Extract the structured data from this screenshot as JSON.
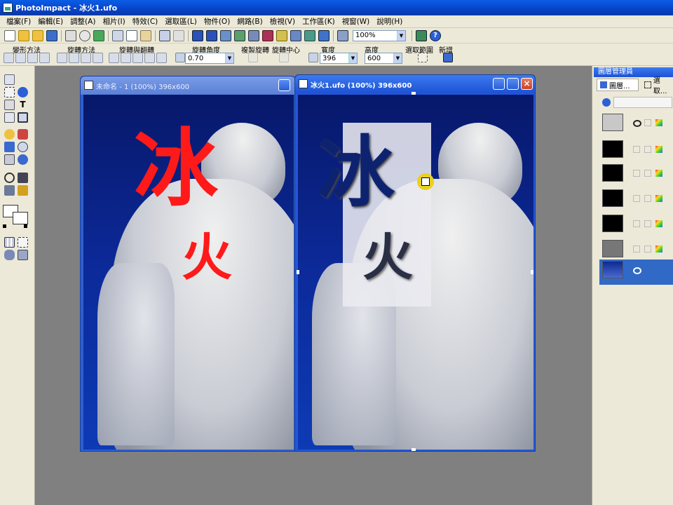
{
  "app": {
    "title": "PhotoImpact - 冰火1.ufo"
  },
  "menu": [
    "檔案(F)",
    "編輯(E)",
    "調整(A)",
    "相片(I)",
    "特效(C)",
    "選取區(L)",
    "物件(O)",
    "網路(B)",
    "檢視(V)",
    "工作區(K)",
    "視窗(W)",
    "說明(H)"
  ],
  "toolbar": {
    "zoom_value": "100%"
  },
  "attr_bar": {
    "transform_method": "變形方法",
    "rotate_method": "旋轉方法",
    "rotate_flip": "旋轉與翻轉",
    "rotate_angle": "旋轉角度",
    "angle_value": "0.70",
    "copy_rotate": "複製旋轉",
    "rotate_center": "旋轉中心",
    "width_label": "寬度",
    "width_value": "396",
    "height_label": "高度",
    "height_value": "600",
    "select_range": "選取範圍",
    "new_label": "新增"
  },
  "doc1": {
    "title": "未命名 - 1 (100%) 396x600",
    "text_large": "冰",
    "text_small": "火"
  },
  "doc2": {
    "title": "冰火1.ufo (100%) 396x600",
    "text_large": "冰",
    "text_small": "火"
  },
  "layer_manager": {
    "title": "圖層管理員",
    "tab_layers": "圖層...",
    "tab_select": "選取..."
  },
  "colors": {
    "title_blue": "#0a5ee6",
    "red_text": "#ff1a1a",
    "navy_text": "#0e2370"
  },
  "icons": [
    "new-icon",
    "open-icon",
    "save-icon",
    "print-icon",
    "undo-icon",
    "redo-icon",
    "cut-icon",
    "copy-icon",
    "paste-icon",
    "help-icon"
  ]
}
